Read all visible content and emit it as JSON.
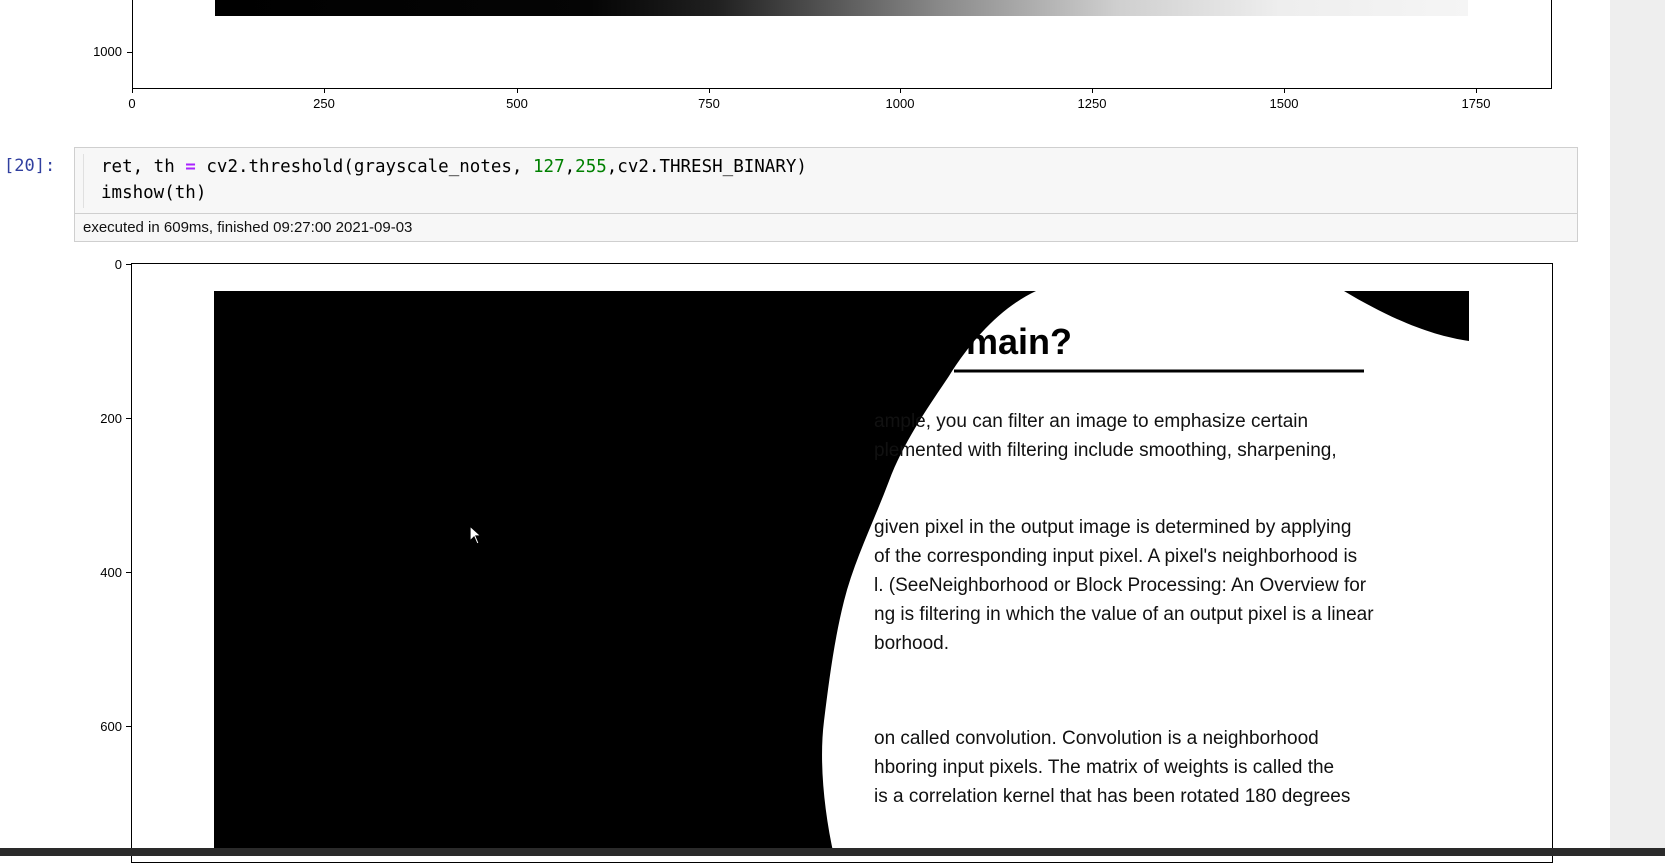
{
  "top_plot": {
    "y_ticks": [
      "1000"
    ],
    "x_ticks": [
      "0",
      "250",
      "500",
      "750",
      "1000",
      "1250",
      "1500",
      "1750"
    ]
  },
  "cell": {
    "prompt": "[20]:",
    "code_line1": {
      "a": "ret, th ",
      "op": "=",
      "b": " cv2.threshold(grayscale_notes, ",
      "n1": "127",
      "c": ",",
      "n2": "255",
      "d": ",cv2.THRESH_BINARY)"
    },
    "code_line2": "imshow(th)",
    "exec_info": "executed in 609ms, finished 09:27:00 2021-09-03"
  },
  "bottom_plot": {
    "y_ticks": [
      "0",
      "200",
      "400",
      "600"
    ]
  },
  "image_text": {
    "heading": "omain?",
    "lines": [
      "ample, you can filter an image to emphasize certain",
      "plemented with filtering include smoothing, sharpening,",
      "given pixel in the output image is determined by applying",
      "of the corresponding input pixel. A pixel's neighborhood is",
      "l. (SeeNeighborhood or Block Processing: An Overview for",
      "ng is filtering in which the value of an output pixel is a linear",
      "borhood.",
      "on called convolution. Convolution is a neighborhood",
      "hboring input pixels. The matrix of weights is called the",
      "is a correlation kernel that has been rotated 180 degrees"
    ]
  }
}
